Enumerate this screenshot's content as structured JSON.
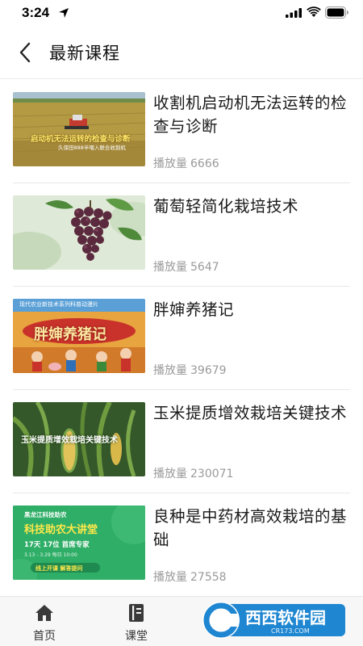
{
  "status_bar": {
    "time": "3:24"
  },
  "nav": {
    "title": "最新课程"
  },
  "courses": [
    {
      "title": "收割机启动机无法运转的检查与诊断",
      "play_label": "播放量",
      "play_count": "6666",
      "thumb_text": "启动机无法运转的检查与诊断",
      "thumb_sub": "久保田888半喂入联合收割机",
      "thumb_colors": {
        "sky": "#9fb8c9",
        "field": "#b9a14a",
        "ground": "#8b6a2d"
      }
    },
    {
      "title": "葡萄轻简化栽培技术",
      "play_label": "播放量",
      "play_count": "5647",
      "thumb_colors": {
        "bg": "#d8e6cf",
        "grape": "#5c2a3e",
        "leaf": "#4f8a3a"
      }
    },
    {
      "title": "胖婶养猪记",
      "play_label": "播放量",
      "play_count": "39679",
      "thumb_text": "胖婶养猪记",
      "thumb_sub": "现代农业新技术系列科普动漫片",
      "thumb_colors": {
        "bg": "#e9a23b",
        "title": "#fbe7a0",
        "accent": "#c9322b"
      }
    },
    {
      "title": "玉米提质增效栽培关键技术",
      "play_label": "播放量",
      "play_count": "230071",
      "thumb_text": "玉米提质增效栽培关键技术",
      "thumb_colors": {
        "bg": "#3f6a2c",
        "leaf": "#6f9c3e",
        "corn": "#e2c35a"
      }
    },
    {
      "title": "良种是中药材高效栽培的基础",
      "play_label": "播放量",
      "play_count": "27558",
      "thumb_text": "科技助农大讲堂",
      "thumb_top": "黑龙江科技助农",
      "thumb_sub": "17天 17位 首席专家",
      "thumb_date": "3.13 - 3.29 每日 10:00",
      "thumb_foot": "线上开课 解答提问",
      "thumb_colors": {
        "bg": "#2fae67",
        "title": "#ffe84a"
      }
    }
  ],
  "tabs": [
    {
      "label": "首页"
    },
    {
      "label": "课堂"
    }
  ],
  "watermark": {
    "name": "西西软件园",
    "domain": "CR173.COM"
  }
}
